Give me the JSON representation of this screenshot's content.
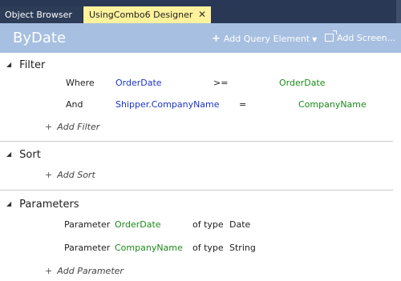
{
  "tabs": [
    {
      "label": "Object Browser"
    },
    {
      "label": "UsingCombo6 Designer",
      "close_glyph": "✕"
    }
  ],
  "header": {
    "title": "ByDate",
    "add_query_element": "Add Query Element",
    "add_screen": "Add Screen..."
  },
  "filter": {
    "heading": "Filter",
    "rows": [
      {
        "connector": "Where",
        "field": "OrderDate",
        "operator": ">=",
        "value": "OrderDate"
      },
      {
        "connector": "And",
        "field": "Shipper.CompanyName",
        "operator": "=",
        "value": "CompanyName"
      }
    ],
    "add_label": "Add Filter"
  },
  "sort": {
    "heading": "Sort",
    "add_label": "Add Sort"
  },
  "parameters": {
    "heading": "Parameters",
    "rows": [
      {
        "keyword": "Parameter",
        "name": "OrderDate",
        "of_type": "of type",
        "type": "Date"
      },
      {
        "keyword": "Parameter",
        "name": "CompanyName",
        "of_type": "of type",
        "type": "String"
      }
    ],
    "add_label": "Add Parameter"
  },
  "colors": {
    "tab_strip": "#293955",
    "active_tab": "#fff29d",
    "title_bar": "#a7bfe0",
    "field_blue": "#1a34c4",
    "value_green": "#1b8a1b"
  }
}
